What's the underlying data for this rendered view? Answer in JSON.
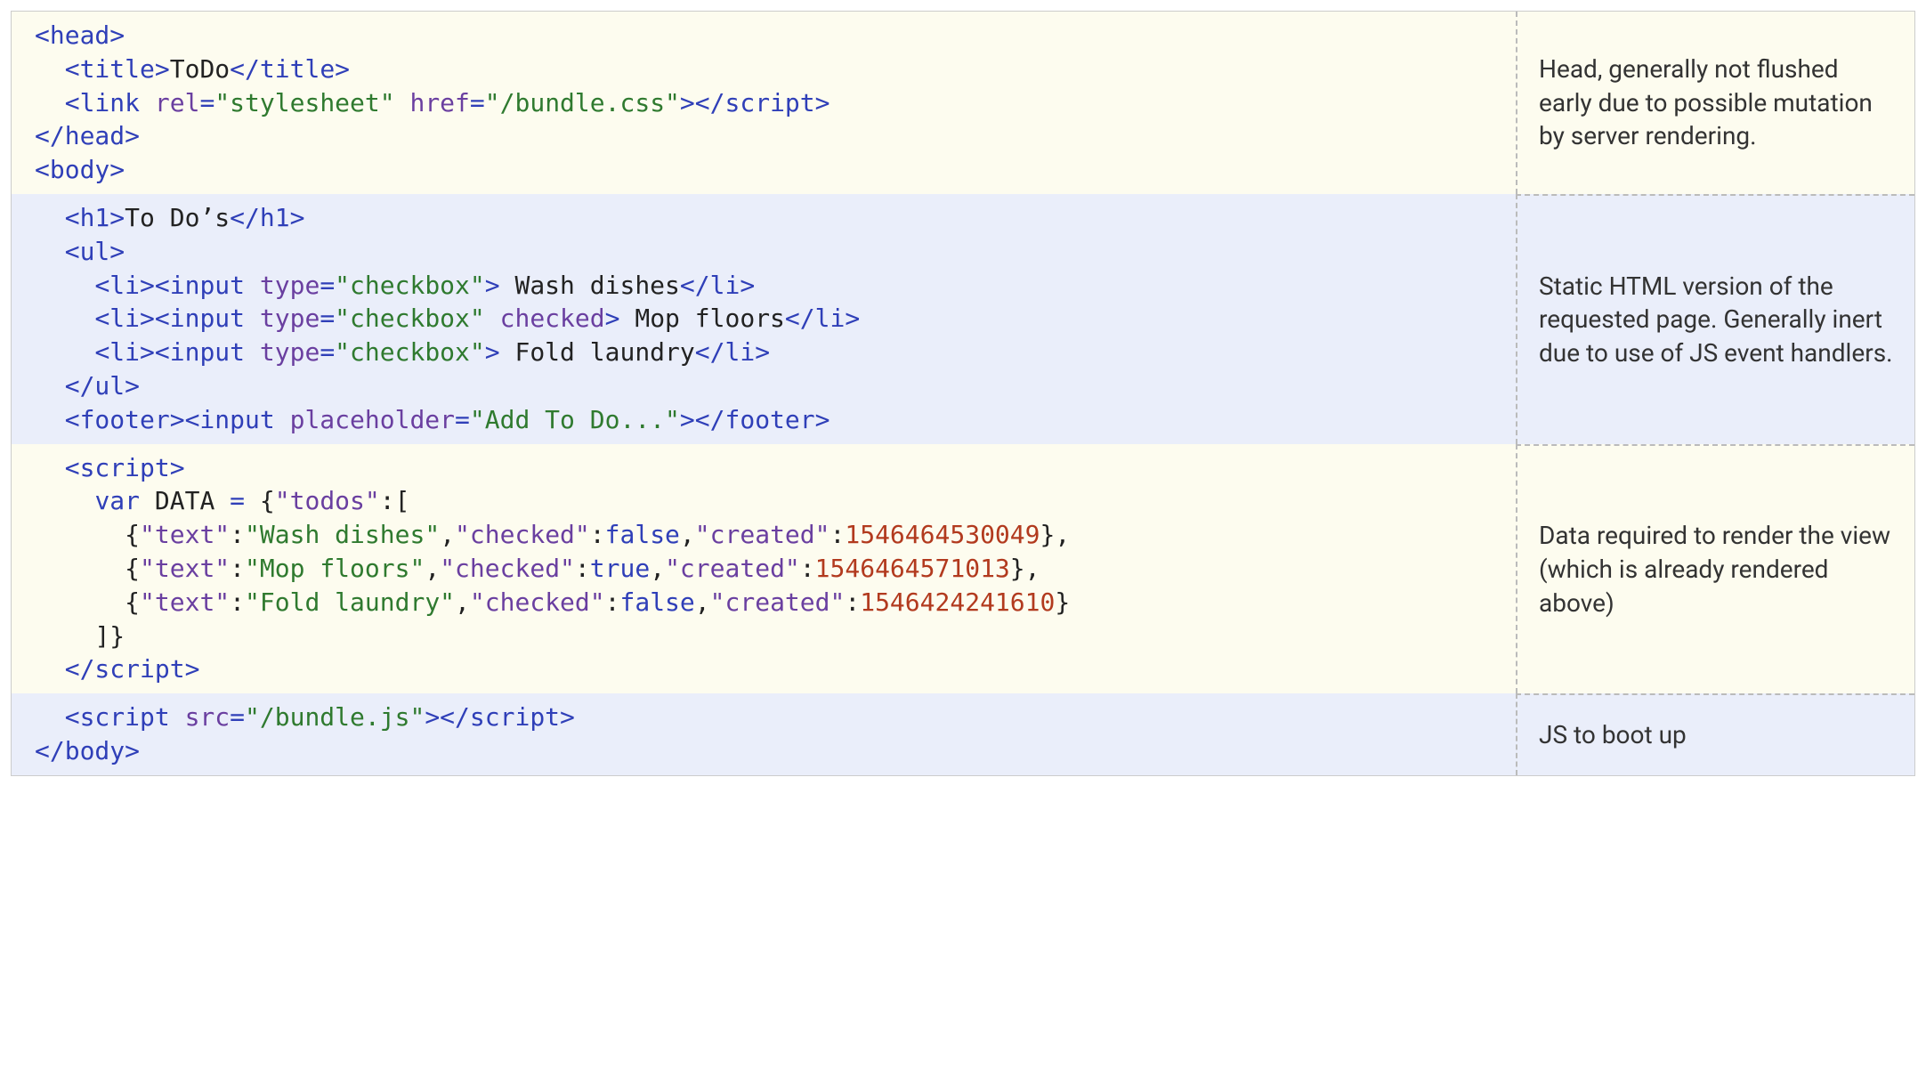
{
  "sections": [
    {
      "bg": "cream",
      "desc": "Head, generally not flushed early due to possible mutation by server rendering.",
      "code": [
        [
          {
            "c": "tag",
            "t": "<head>"
          }
        ],
        [
          {
            "c": null,
            "t": "  "
          },
          {
            "c": "tag",
            "t": "<title>"
          },
          {
            "c": "txt",
            "t": "ToDo"
          },
          {
            "c": "tag",
            "t": "</title>"
          }
        ],
        [
          {
            "c": null,
            "t": "  "
          },
          {
            "c": "tag",
            "t": "<link "
          },
          {
            "c": "attr",
            "t": "rel"
          },
          {
            "c": "tag",
            "t": "="
          },
          {
            "c": "str",
            "t": "\"stylesheet\""
          },
          {
            "c": "tag",
            "t": " "
          },
          {
            "c": "attr",
            "t": "href"
          },
          {
            "c": "tag",
            "t": "="
          },
          {
            "c": "str",
            "t": "\"/bundle.css\""
          },
          {
            "c": "tag",
            "t": "></script"
          },
          {
            "c": "tag",
            "t": ">"
          }
        ],
        [
          {
            "c": "tag",
            "t": "</head>"
          }
        ],
        [
          {
            "c": "tag",
            "t": "<body>"
          }
        ]
      ]
    },
    {
      "bg": "blue",
      "desc": "Static HTML version of the requested page. Generally inert due to use of JS event handlers.",
      "code": [
        [
          {
            "c": null,
            "t": "  "
          },
          {
            "c": "tag",
            "t": "<h1>"
          },
          {
            "c": "txt",
            "t": "To Do’s"
          },
          {
            "c": "tag",
            "t": "</h1>"
          }
        ],
        [
          {
            "c": null,
            "t": "  "
          },
          {
            "c": "tag",
            "t": "<ul>"
          }
        ],
        [
          {
            "c": null,
            "t": "    "
          },
          {
            "c": "tag",
            "t": "<li><input "
          },
          {
            "c": "attr",
            "t": "type"
          },
          {
            "c": "tag",
            "t": "="
          },
          {
            "c": "str",
            "t": "\"checkbox\""
          },
          {
            "c": "tag",
            "t": ">"
          },
          {
            "c": "txt",
            "t": " Wash dishes"
          },
          {
            "c": "tag",
            "t": "</li>"
          }
        ],
        [
          {
            "c": null,
            "t": "    "
          },
          {
            "c": "tag",
            "t": "<li><input "
          },
          {
            "c": "attr",
            "t": "type"
          },
          {
            "c": "tag",
            "t": "="
          },
          {
            "c": "str",
            "t": "\"checkbox\""
          },
          {
            "c": "tag",
            "t": " "
          },
          {
            "c": "attr",
            "t": "checked"
          },
          {
            "c": "tag",
            "t": ">"
          },
          {
            "c": "txt",
            "t": " Mop floors"
          },
          {
            "c": "tag",
            "t": "</li>"
          }
        ],
        [
          {
            "c": null,
            "t": "    "
          },
          {
            "c": "tag",
            "t": "<li><input "
          },
          {
            "c": "attr",
            "t": "type"
          },
          {
            "c": "tag",
            "t": "="
          },
          {
            "c": "str",
            "t": "\"checkbox\""
          },
          {
            "c": "tag",
            "t": ">"
          },
          {
            "c": "txt",
            "t": " Fold laundry"
          },
          {
            "c": "tag",
            "t": "</li>"
          }
        ],
        [
          {
            "c": null,
            "t": "  "
          },
          {
            "c": "tag",
            "t": "</ul>"
          }
        ],
        [
          {
            "c": null,
            "t": "  "
          },
          {
            "c": "tag",
            "t": "<footer><input "
          },
          {
            "c": "attr",
            "t": "placeholder"
          },
          {
            "c": "tag",
            "t": "="
          },
          {
            "c": "str",
            "t": "\"Add To Do...\""
          },
          {
            "c": "tag",
            "t": "></footer>"
          }
        ]
      ]
    },
    {
      "bg": "cream",
      "desc": "Data required to render the view (which is already rendered above)",
      "code": [
        [
          {
            "c": null,
            "t": "  "
          },
          {
            "c": "tag",
            "t": "<script"
          },
          {
            "c": "tag",
            "t": ">"
          }
        ],
        [
          {
            "c": null,
            "t": "    "
          },
          {
            "c": "jskey",
            "t": "var"
          },
          {
            "c": "jsvar",
            "t": " DATA "
          },
          {
            "c": "tag",
            "t": "="
          },
          {
            "c": "jsvar",
            "t": " "
          },
          {
            "c": "txt",
            "t": "{"
          },
          {
            "c": "jsstrkey",
            "t": "\"todos\""
          },
          {
            "c": "txt",
            "t": ":["
          }
        ],
        [
          {
            "c": null,
            "t": "      "
          },
          {
            "c": "txt",
            "t": "{"
          },
          {
            "c": "jsstrkey",
            "t": "\"text\""
          },
          {
            "c": "txt",
            "t": ":"
          },
          {
            "c": "jsstr",
            "t": "\"Wash dishes\""
          },
          {
            "c": "txt",
            "t": ","
          },
          {
            "c": "jsstrkey",
            "t": "\"checked\""
          },
          {
            "c": "txt",
            "t": ":"
          },
          {
            "c": "jsbool",
            "t": "false"
          },
          {
            "c": "txt",
            "t": ","
          },
          {
            "c": "jsstrkey",
            "t": "\"created\""
          },
          {
            "c": "txt",
            "t": ":"
          },
          {
            "c": "jsnum",
            "t": "1546464530049"
          },
          {
            "c": "txt",
            "t": "},"
          }
        ],
        [
          {
            "c": null,
            "t": "      "
          },
          {
            "c": "txt",
            "t": "{"
          },
          {
            "c": "jsstrkey",
            "t": "\"text\""
          },
          {
            "c": "txt",
            "t": ":"
          },
          {
            "c": "jsstr",
            "t": "\"Mop floors\""
          },
          {
            "c": "txt",
            "t": ","
          },
          {
            "c": "jsstrkey",
            "t": "\"checked\""
          },
          {
            "c": "txt",
            "t": ":"
          },
          {
            "c": "jsbool",
            "t": "true"
          },
          {
            "c": "txt",
            "t": ","
          },
          {
            "c": "jsstrkey",
            "t": "\"created\""
          },
          {
            "c": "txt",
            "t": ":"
          },
          {
            "c": "jsnum",
            "t": "1546464571013"
          },
          {
            "c": "txt",
            "t": "},"
          }
        ],
        [
          {
            "c": null,
            "t": "      "
          },
          {
            "c": "txt",
            "t": "{"
          },
          {
            "c": "jsstrkey",
            "t": "\"text\""
          },
          {
            "c": "txt",
            "t": ":"
          },
          {
            "c": "jsstr",
            "t": "\"Fold laundry\""
          },
          {
            "c": "txt",
            "t": ","
          },
          {
            "c": "jsstrkey",
            "t": "\"checked\""
          },
          {
            "c": "txt",
            "t": ":"
          },
          {
            "c": "jsbool",
            "t": "false"
          },
          {
            "c": "txt",
            "t": ","
          },
          {
            "c": "jsstrkey",
            "t": "\"created\""
          },
          {
            "c": "txt",
            "t": ":"
          },
          {
            "c": "jsnum",
            "t": "1546424241610"
          },
          {
            "c": "txt",
            "t": "}"
          }
        ],
        [
          {
            "c": null,
            "t": "    "
          },
          {
            "c": "txt",
            "t": "]}"
          }
        ],
        [
          {
            "c": null,
            "t": "  "
          },
          {
            "c": "tag",
            "t": "</script"
          },
          {
            "c": "tag",
            "t": ">"
          }
        ]
      ]
    },
    {
      "bg": "blue",
      "desc": "JS to boot up",
      "code": [
        [
          {
            "c": null,
            "t": "  "
          },
          {
            "c": "tag",
            "t": "<script "
          },
          {
            "c": "attr",
            "t": "src"
          },
          {
            "c": "tag",
            "t": "="
          },
          {
            "c": "str",
            "t": "\"/bundle.js\""
          },
          {
            "c": "tag",
            "t": "></script"
          },
          {
            "c": "tag",
            "t": ">"
          }
        ],
        [
          {
            "c": "tag",
            "t": "</body>"
          }
        ]
      ]
    }
  ]
}
